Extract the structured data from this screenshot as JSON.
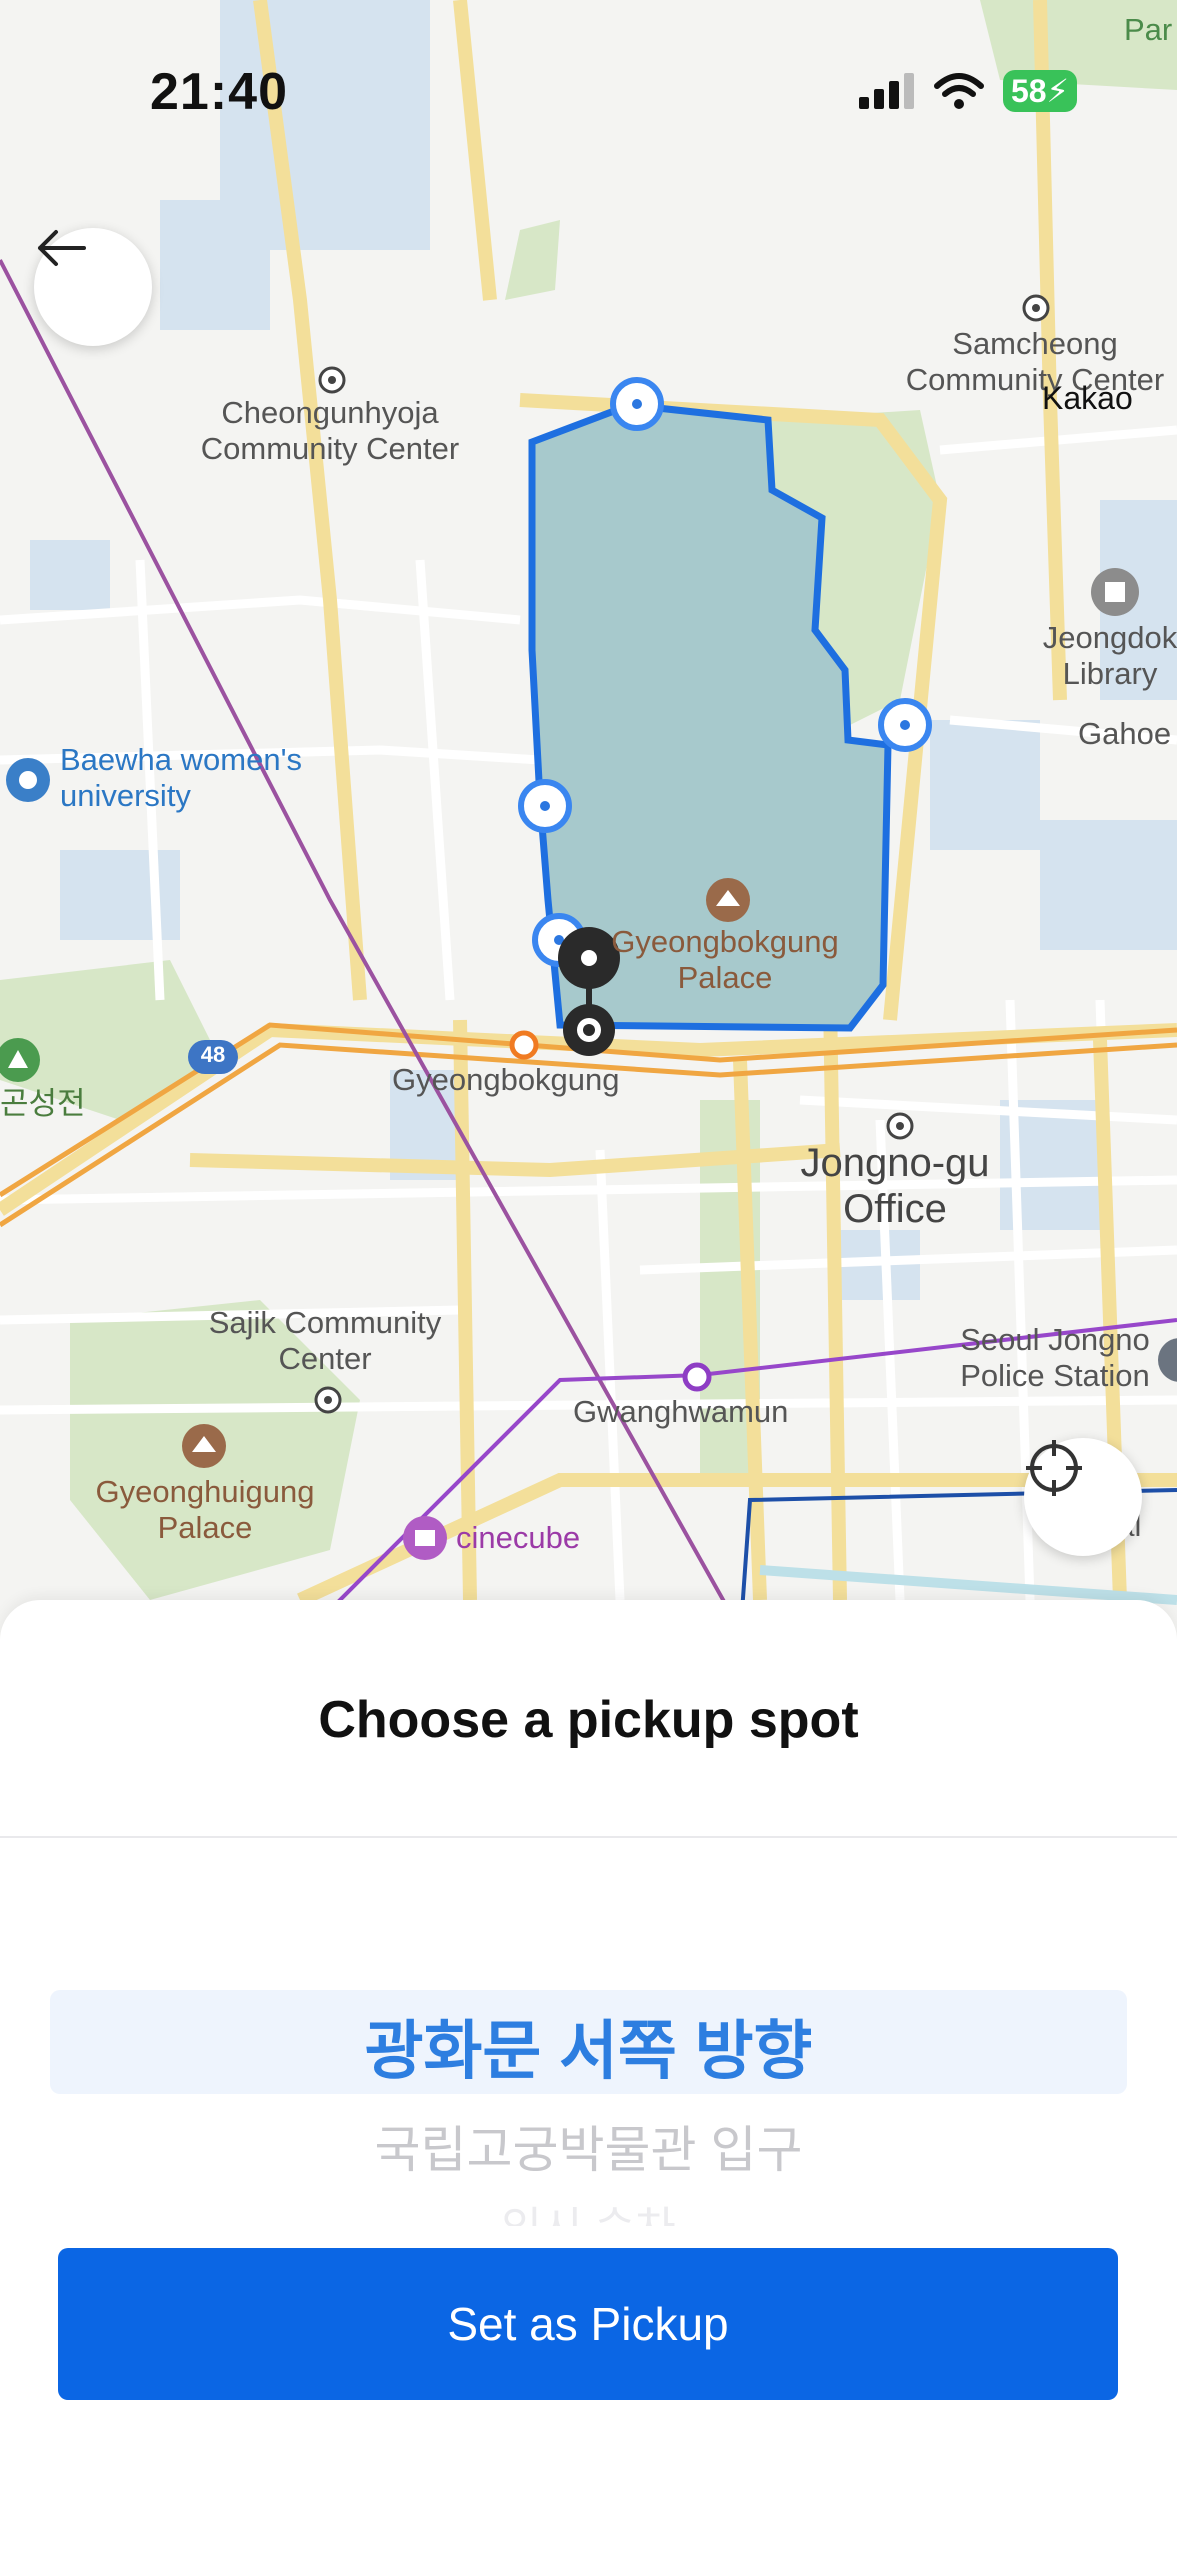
{
  "status_bar": {
    "time": "21:40",
    "battery": "58"
  },
  "map": {
    "watermark": "Kakao",
    "labels": {
      "park": "Par",
      "samcheong": "Samcheong Community Center",
      "cheongunhyoja": "Cheongunhyoja Community Center",
      "jeongdok": "Jeongdok Library",
      "gahoe": "Gahoe",
      "baewha": "Baewha women's university",
      "gyeongbokgung_palace": "Gyeongbokgung Palace",
      "route_48": "48",
      "gyeongbokgung_station": "Gyeongbokgung",
      "jongno_office": "Jongno-gu Office",
      "sajik": "Sajik Community Center",
      "seoul_police": "Seoul Jongno Police Station",
      "gwanghwamun": "Gwanghwamun",
      "gyeonghuigung": "Gyeonghuigung Palace",
      "cinecube": "cinecube",
      "left_edge": "곤성전",
      "right_edge": "gal"
    }
  },
  "buttons": {
    "set_pickup": "Set as Pickup"
  },
  "sheet": {
    "title": "Choose a pickup spot",
    "picker": {
      "selected": "광화문 서쪽 방향",
      "next": "국립고궁박물관 입구",
      "faded": "임시 승차"
    }
  },
  "colors": {
    "accent": "#0b66e4",
    "selected_text": "#2d7ee0",
    "zone_fill": "#a7c9cc",
    "zone_stroke": "#1e6fe0",
    "battery": "#39c259"
  },
  "icons": {
    "back": "arrow-left-icon",
    "locate": "crosshair-icon",
    "signal": "signal-icon",
    "wifi": "wifi-icon",
    "battery": "battery-icon"
  }
}
